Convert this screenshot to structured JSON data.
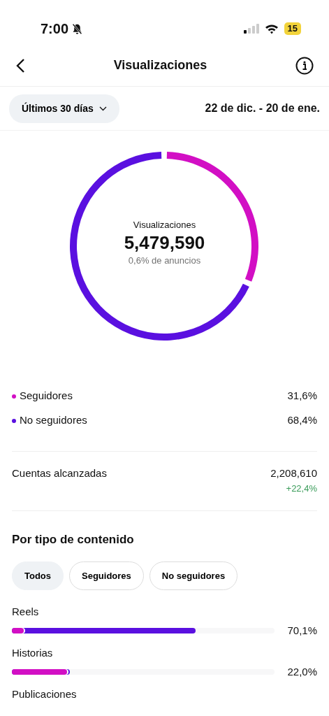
{
  "status_bar": {
    "time": "7:00",
    "battery": "15"
  },
  "header": {
    "title": "Visualizaciones"
  },
  "filter": {
    "range": "Últimos 30 días",
    "dates": "22 de dic. - 20 de ene."
  },
  "donut": {
    "label": "Visualizaciones",
    "total": "5,479,590",
    "note": "0,6% de anuncios",
    "chart_data": {
      "type": "donut",
      "values": [
        31.6,
        68.4
      ]
    }
  },
  "legend": [
    {
      "label": "Seguidores",
      "value": "31,6%",
      "color": "#d20fc4"
    },
    {
      "label": "No seguidores",
      "value": "68,4%",
      "color": "#5a10e0"
    }
  ],
  "reach": {
    "label": "Cuentas alcanzadas",
    "value": "2,208,610",
    "change": "+22,4%"
  },
  "content": {
    "title": "Por tipo de contenido",
    "chips": [
      {
        "label": "Todos",
        "selected": true
      },
      {
        "label": "Seguidores",
        "selected": false
      },
      {
        "label": "No seguidores",
        "selected": false
      }
    ],
    "rows": [
      {
        "label": "Reels",
        "value": "70,1%",
        "fills": [
          {
            "level": 0.7
          },
          {
            "level": 0.045
          }
        ]
      },
      {
        "label": "Historias",
        "value": "22,0%",
        "fills": [
          {
            "level": 0.22
          },
          {
            "level": 0.21
          }
        ]
      },
      {
        "label": "Publicaciones"
      }
    ]
  }
}
